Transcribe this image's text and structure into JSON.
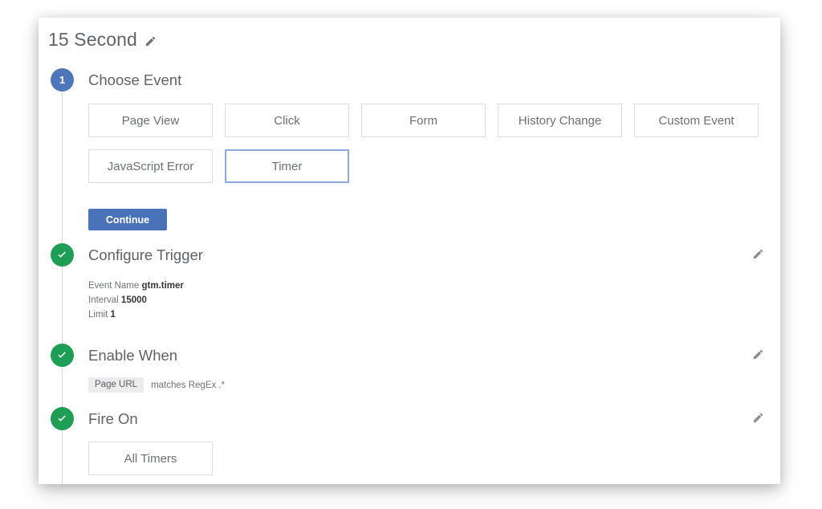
{
  "trigger": {
    "title": "15 Second",
    "edit_icon": "pencil-icon"
  },
  "steps": [
    {
      "id": "choose-event",
      "badge": "1",
      "badge_state": "active",
      "title": "Choose Event"
    },
    {
      "id": "configure-trigger",
      "badge": "check-icon",
      "badge_state": "complete",
      "title": "Configure Trigger"
    },
    {
      "id": "enable-when",
      "badge": "check-icon",
      "badge_state": "complete",
      "title": "Enable When"
    },
    {
      "id": "fire-on",
      "badge": "check-icon",
      "badge_state": "complete",
      "title": "Fire On"
    }
  ],
  "choose_event": {
    "options": [
      {
        "label": "Page View",
        "selected": false
      },
      {
        "label": "Click",
        "selected": false
      },
      {
        "label": "Form",
        "selected": false
      },
      {
        "label": "History Change",
        "selected": false
      },
      {
        "label": "Custom Event",
        "selected": false
      },
      {
        "label": "JavaScript Error",
        "selected": false
      },
      {
        "label": "Timer",
        "selected": true
      }
    ],
    "continue_label": "Continue"
  },
  "configure_trigger": {
    "details": [
      {
        "label": "Event Name",
        "value": "gtm.timer"
      },
      {
        "label": "Interval",
        "value": "15000"
      },
      {
        "label": "Limit",
        "value": "1"
      }
    ]
  },
  "enable_when": {
    "condition": {
      "variable": "Page URL",
      "operator_and_value": "matches RegEx .*"
    }
  },
  "fire_on": {
    "options": [
      {
        "label": "All Timers",
        "selected": false
      }
    ]
  },
  "colors": {
    "accent_blue": "#4d77b8",
    "button_blue": "#4a72b8",
    "selected_border": "#8aaad8",
    "complete_green": "#1e9e55",
    "text_grey": "#5f6368",
    "chip_bg": "#ececec"
  }
}
